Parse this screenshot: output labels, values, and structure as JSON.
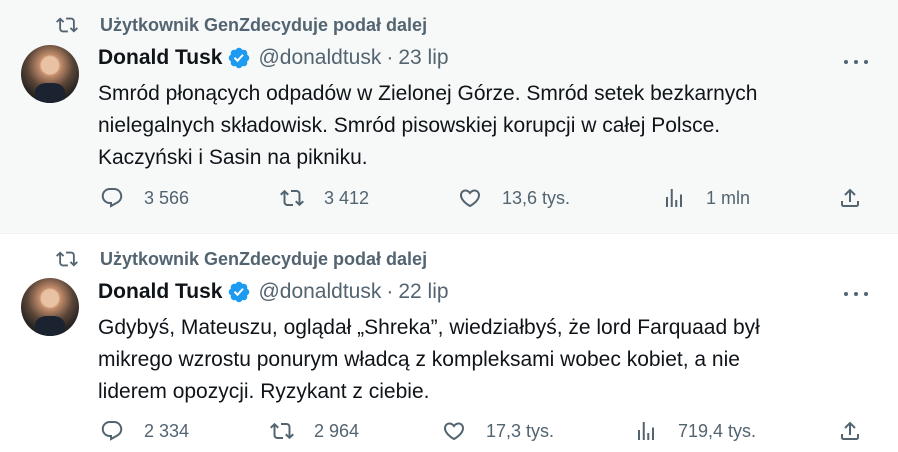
{
  "tweets": [
    {
      "retweet_label": "Użytkownik GenZdecyduje podał dalej",
      "author_name": "Donald Tusk",
      "handle": "@donaldtusk",
      "separator": "·",
      "date": "23 lip",
      "lines": [
        "Smród płonących odpadów w Zielonej Górze. Smród setek bezkarnych",
        "nielegalnych składowisk. Smród pisowskiej korupcji w całej Polsce.",
        "Kaczyński i Sasin na pikniku."
      ],
      "replies": "3 566",
      "reposts": "3 412",
      "likes": "13,6 tys.",
      "views": "1 mln"
    },
    {
      "retweet_label": "Użytkownik GenZdecyduje podał dalej",
      "author_name": "Donald Tusk",
      "handle": "@donaldtusk",
      "separator": "·",
      "date": "22 lip",
      "lines": [
        "Gdybyś, Mateuszu, oglądał „Shreka”, wiedziałbyś, że lord Farquaad był",
        "mikrego wzrostu ponurym władcą z kompleksami wobec kobiet, a nie",
        "liderem opozycji. Ryzykant z ciebie."
      ],
      "replies": "2 334",
      "reposts": "2 964",
      "likes": "17,3 tys.",
      "views": "719,4 tys."
    }
  ],
  "icons": {
    "retweet_indicator": "repost-icon",
    "verified": "verified-badge-icon",
    "more": "more-icon",
    "reply": "reply-icon",
    "repost": "repost-icon",
    "like": "heart-icon",
    "views": "views-icon",
    "share": "share-icon"
  },
  "colors": {
    "text": "#0f1419",
    "secondary": "#536471",
    "verified": "#1d9bf0",
    "highlight_bg": "#f7f9f9"
  }
}
